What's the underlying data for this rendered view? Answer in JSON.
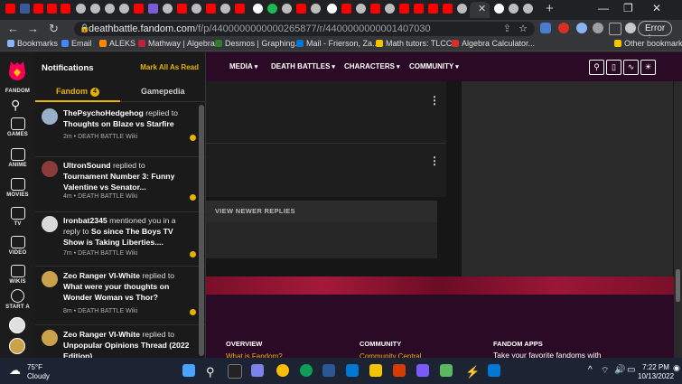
{
  "browser": {
    "url_host": "deathbattle.fandom.com",
    "url_path": "/f/p/4400000000000265877/r/4400000000001407030",
    "error_label": "Error"
  },
  "bookmarks": [
    {
      "label": "Bookmarks",
      "color": "#8ab4f8"
    },
    {
      "label": "Email",
      "color": "#4285f4"
    },
    {
      "label": "ALEKS",
      "color": "#ff8800"
    },
    {
      "label": "Mathway | Algebra...",
      "color": "#c41e3a"
    },
    {
      "label": "Desmos | Graphing...",
      "color": "#2e7d32"
    },
    {
      "label": "Mail - Frierson, Za...",
      "color": "#0078d4"
    },
    {
      "label": "Math tutors: TLCC...",
      "color": "#f5c400"
    },
    {
      "label": "Algebra Calculator...",
      "color": "#d32f2f"
    },
    {
      "label": "Other bookmarks",
      "color": "#f5c400"
    }
  ],
  "rail": [
    {
      "label": "FANDOM"
    },
    {
      "label": "GAMES"
    },
    {
      "label": "ANIME"
    },
    {
      "label": "MOVIES"
    },
    {
      "label": "TV"
    },
    {
      "label": "VIDEO"
    },
    {
      "label": "WIKIS"
    },
    {
      "label": "START A"
    }
  ],
  "notifications": {
    "title": "Notifications",
    "mark_all": "Mark All As Read",
    "tab_fandom": "Fandom",
    "tab_fandom_count": "4",
    "tab_gamepedia": "Gamepedia",
    "items": [
      {
        "user": "ThePsychoHedgehog",
        "action": " replied to ",
        "target": "Thoughts on Blaze vs Starfire",
        "meta": "2m • DEATH BATTLE Wiki",
        "avatar": "#9ab0c8"
      },
      {
        "user": "UltronSound",
        "action": " replied to ",
        "target": "Tournament Number 3: Funny Valentine vs Senator...",
        "meta": "4m • DEATH BATTLE Wiki",
        "avatar": "#8a3b3b"
      },
      {
        "user": "Ironbat2345",
        "action": " mentioned you in a reply to ",
        "target": "So since The Boys TV Show is Taking Liberties....",
        "meta": "7m • DEATH BATTLE Wiki",
        "avatar": "#d9d9d9"
      },
      {
        "user": "Zeo Ranger VI-White",
        "action": " replied to ",
        "target": "What were your thoughts on Wonder Woman vs Thor?",
        "meta": "8m • DEATH BATTLE Wiki",
        "avatar": "#c9a24a"
      },
      {
        "user": "Zeo Ranger VI-White",
        "action": " replied to ",
        "target": "Unpopular Opinions Thread (2022 Edition)",
        "meta": "",
        "avatar": "#c9a24a"
      }
    ]
  },
  "topnav": {
    "items": [
      "MEDIA",
      "DEATH BATTLES",
      "CHARACTERS",
      "COMMUNITY"
    ]
  },
  "content": {
    "view_newer": "VIEW NEWER REPLIES"
  },
  "footer": {
    "overview": "OVERVIEW",
    "overview_link": "What is Fandom?",
    "community": "COMMUNITY",
    "community_link": "Community Central",
    "apps": "FANDOM APPS",
    "apps_text": "Take your favorite fandoms with"
  },
  "taskbar": {
    "temp": "75°F",
    "condition": "Cloudy",
    "time": "7:22 PM",
    "date": "10/13/2022"
  },
  "colors": {
    "accent": "#e6b400",
    "fandom_purple": "#2b0a26",
    "fandom_red": "#a5193b"
  }
}
